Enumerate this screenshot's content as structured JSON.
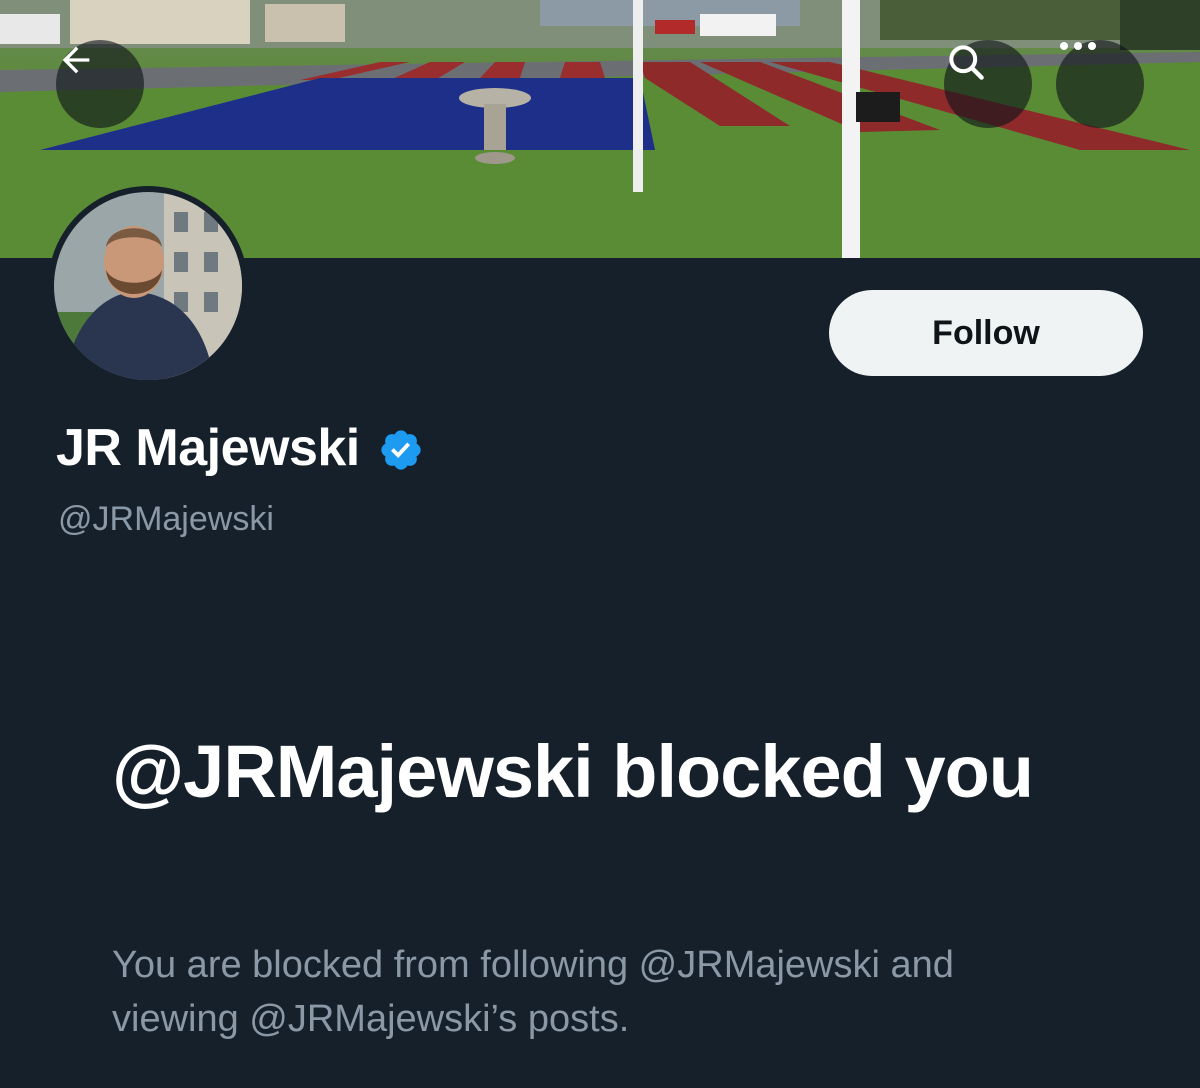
{
  "profile": {
    "display_name": "JR Majewski",
    "handle": "@JRMajewski",
    "verified": true
  },
  "header": {
    "back_icon": "arrow-left-icon",
    "search_icon": "search-icon",
    "more_icon": "more-horizontal-icon"
  },
  "actions": {
    "follow_label": "Follow"
  },
  "blocked": {
    "title": "@JRMajewski blocked you",
    "description": "You are blocked from following @JRMajewski and viewing @JRMajewski’s posts."
  },
  "colors": {
    "background": "#15202b",
    "primary_text": "#ffffff",
    "secondary_text": "#8b98a5",
    "follow_button_bg": "#eff3f4",
    "verified_badge": "#1d9bf0"
  }
}
